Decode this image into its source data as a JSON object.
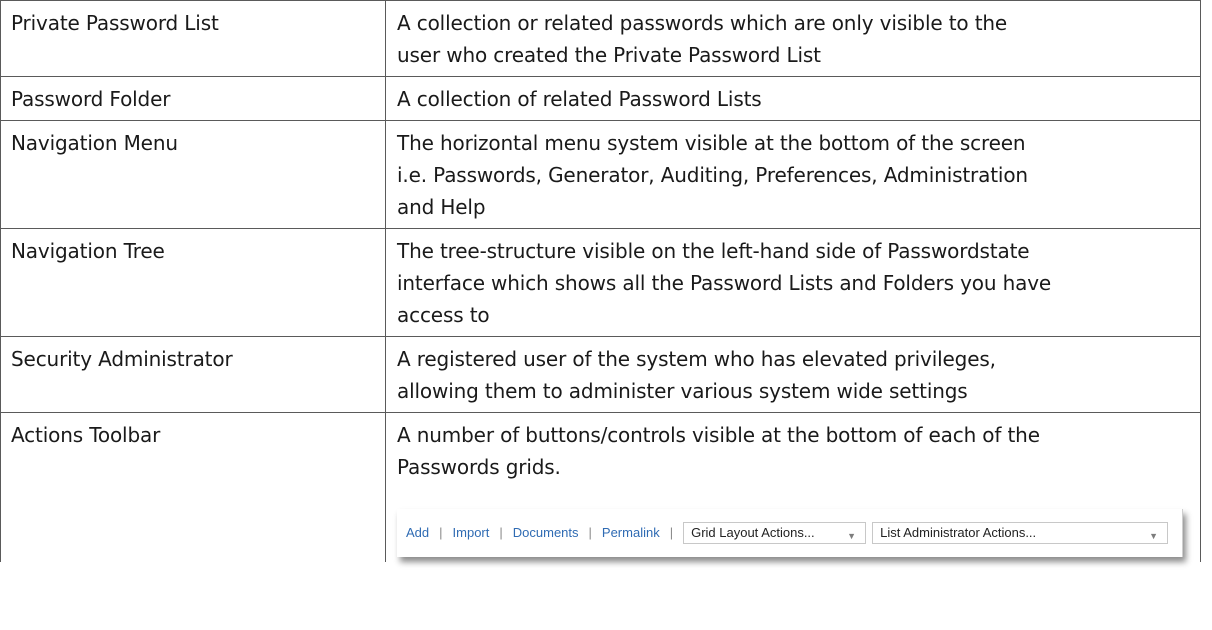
{
  "glossary": {
    "rows": [
      {
        "term": "Private Password List",
        "definition_lines": [
          "A collection or related passwords which are only visible to the",
          "user who created the Private Password List"
        ]
      },
      {
        "term": "Password Folder",
        "definition_lines": [
          "A collection of related Password Lists"
        ]
      },
      {
        "term": "Navigation Menu",
        "definition_lines": [
          "The horizontal menu system visible at the bottom of the screen",
          "i.e. Passwords, Generator, Auditing, Preferences, Administration",
          "and Help"
        ]
      },
      {
        "term": "Navigation Tree",
        "definition_lines": [
          "The tree-structure visible on the left-hand side of Passwordstate",
          "interface which shows all the Password Lists and Folders you have",
          "access to"
        ]
      },
      {
        "term": "Security Administrator",
        "definition_lines": [
          "A registered user of the system who has elevated privileges,",
          "allowing them to administer various system wide settings"
        ]
      },
      {
        "term": "Actions Toolbar",
        "definition_lines": [
          "A number of buttons/controls visible at the bottom of each of the",
          "Passwords grids."
        ]
      }
    ]
  },
  "toolbar": {
    "links": [
      "Add",
      "Import",
      "Documents",
      "Permalink"
    ],
    "separator": "|",
    "grid_layout_select": "Grid Layout Actions...",
    "list_admin_select": "List Administrator Actions...",
    "caret_icon": "caret-down-icon",
    "colors": {
      "link": "#2f6bb3",
      "separator": "#8a8a8a",
      "select_border": "#c8c8c8"
    }
  }
}
